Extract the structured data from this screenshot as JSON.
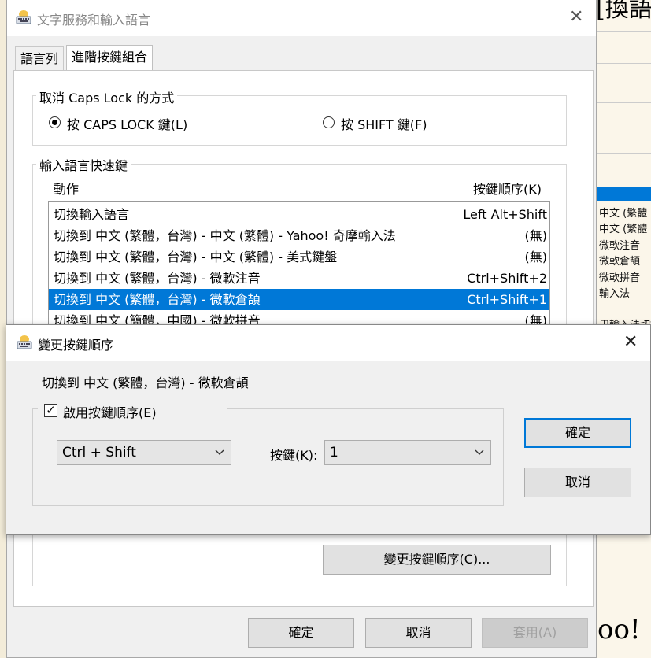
{
  "background_doc": {
    "items": [
      "中文 (繁體",
      "中文 (繁體",
      "微軟注音",
      "微軟倉頡",
      "微軟拼音",
      "輸入法"
    ],
    "text_bottom": "用輸入法切換",
    "big_text_top": "[換語",
    "big_text_bottom": "oo!"
  },
  "main_window": {
    "title": "文字服務和輸入語言",
    "tabs": [
      {
        "label": "語言列",
        "active": false
      },
      {
        "label": "進階按鍵組合",
        "active": true
      }
    ],
    "caps_group": {
      "title": "取消 Caps Lock 的方式",
      "options": [
        {
          "label": "按 CAPS LOCK 鍵(L)",
          "selected": true
        },
        {
          "label": "按 SHIFT 鍵(F)",
          "selected": false
        }
      ]
    },
    "hotkeys_group": {
      "title": "輸入語言快速鍵",
      "col_action": "動作",
      "col_keys": "按鍵順序(K)",
      "rows": [
        {
          "action": "切換輸入語言",
          "keys": "Left Alt+Shift",
          "selected": false
        },
        {
          "action": "切換到 中文 (繁體，台灣) - 中文 (繁體) - Yahoo! 奇摩輸入法",
          "keys": "(無)",
          "selected": false
        },
        {
          "action": "切換到 中文 (繁體，台灣) - 中文 (繁體) - 美式鍵盤",
          "keys": "(無)",
          "selected": false
        },
        {
          "action": "切換到 中文 (繁體，台灣) - 微軟注音",
          "keys": "Ctrl+Shift+2",
          "selected": false
        },
        {
          "action": "切換到 中文 (繁體，台灣) - 微軟倉頡",
          "keys": "Ctrl+Shift+1",
          "selected": true
        },
        {
          "action": "切換到 中文 (簡體，中國) - 微軟拼音",
          "keys": "(無)",
          "selected": false
        }
      ],
      "change_button": "變更按鍵順序(C)..."
    },
    "buttons": {
      "ok": "確定",
      "cancel": "取消",
      "apply": "套用(A)"
    }
  },
  "dialog": {
    "title": "變更按鍵順序",
    "target": "切換到 中文 (繁體，台灣) - 微軟倉頡",
    "enable_label": "啟用按鍵順序(E)",
    "enable_checked": true,
    "modifier_value": "Ctrl + Shift",
    "key_label": "按鍵(K):",
    "key_value": "1",
    "ok": "確定",
    "cancel": "取消"
  },
  "icons": {
    "keyboard": "keyboard-icon",
    "close": "close-icon",
    "chevron": "chevron-down-icon"
  },
  "colors": {
    "selection": "#0078d7",
    "default_button_border": "#0078d7"
  }
}
